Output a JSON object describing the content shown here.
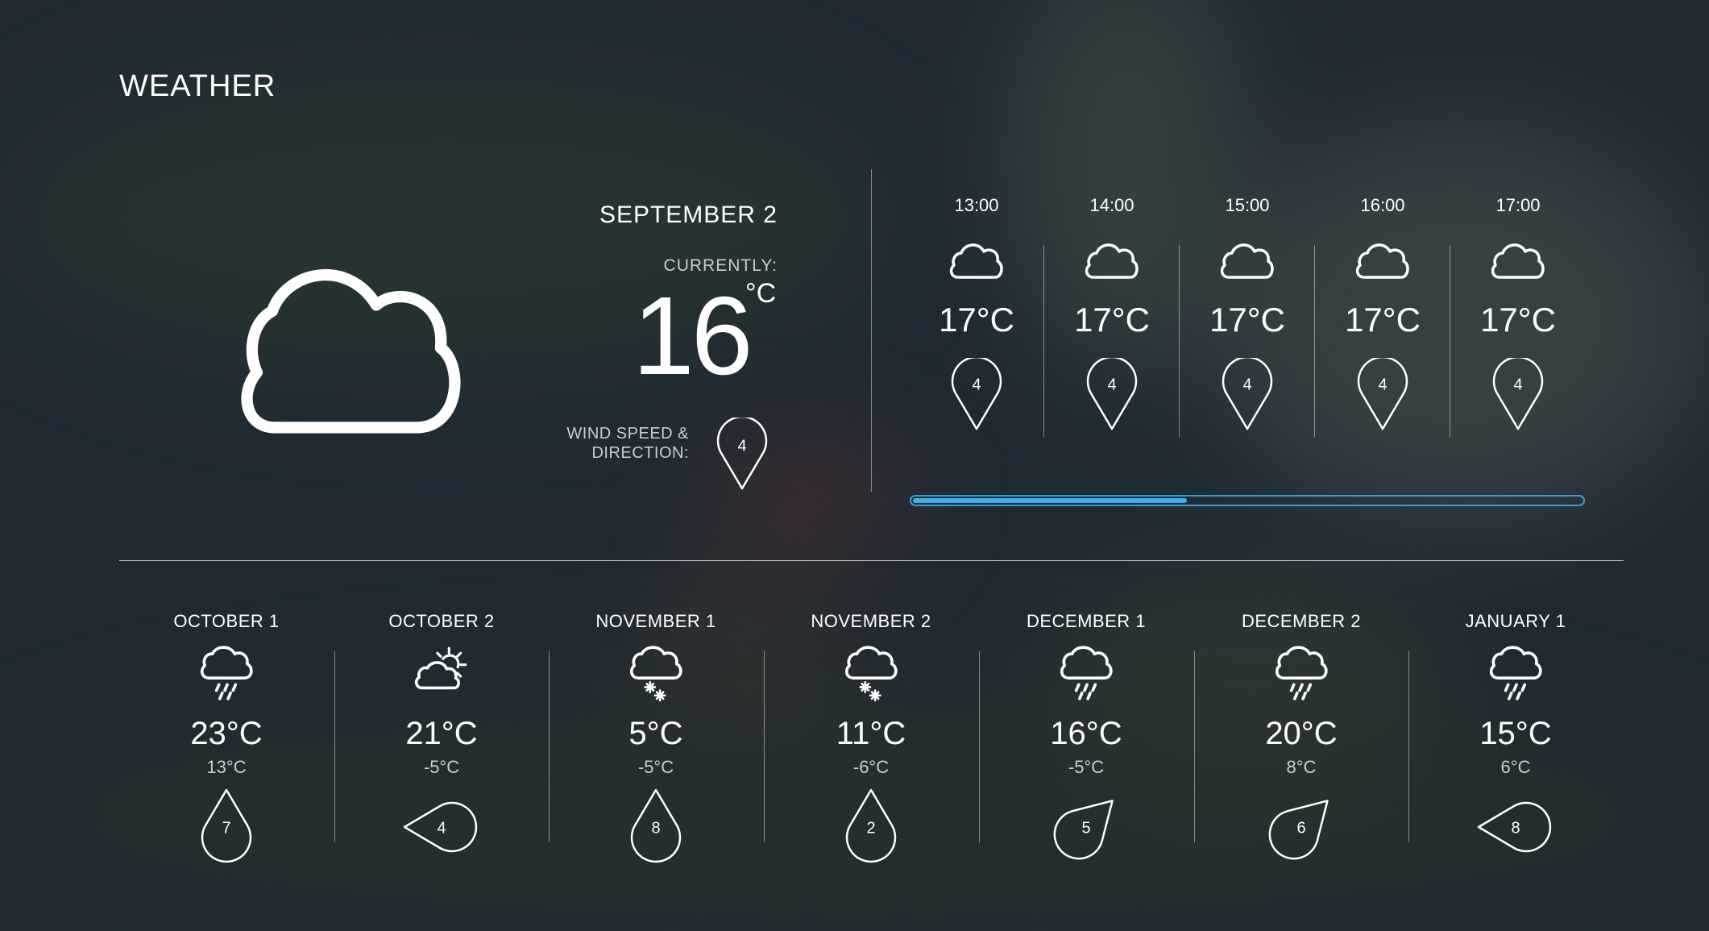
{
  "app": {
    "title": "WEATHER"
  },
  "current": {
    "date": "SEPTEMBER 2",
    "label": "CURRENTLY:",
    "temperature": "16",
    "unit": "°C",
    "icon": "cloud-icon",
    "wind_label": "WIND SPEED & DIRECTION:",
    "wind_speed": "4",
    "wind_direction": "south"
  },
  "hourly": [
    {
      "time": "13:00",
      "icon": "cloud-icon",
      "temp": "17°C",
      "wind_speed": "4",
      "wind_direction": "south"
    },
    {
      "time": "14:00",
      "icon": "cloud-icon",
      "temp": "17°C",
      "wind_speed": "4",
      "wind_direction": "south"
    },
    {
      "time": "15:00",
      "icon": "cloud-icon",
      "temp": "17°C",
      "wind_speed": "4",
      "wind_direction": "south"
    },
    {
      "time": "16:00",
      "icon": "cloud-icon",
      "temp": "17°C",
      "wind_speed": "4",
      "wind_direction": "south"
    },
    {
      "time": "17:00",
      "icon": "cloud-icon",
      "temp": "17°C",
      "wind_speed": "4",
      "wind_direction": "south"
    }
  ],
  "hourly_scroll": {
    "progress": 0.41,
    "color": "#3ab1ec"
  },
  "daily": [
    {
      "date": "OCTOBER 1",
      "icon": "rain-icon",
      "high": "23°C",
      "low": "13°C",
      "wind_speed": "7",
      "wind_direction": "north"
    },
    {
      "date": "OCTOBER 2",
      "icon": "partly-sunny-icon",
      "high": "21°C",
      "low": "-5°C",
      "wind_speed": "4",
      "wind_direction": "west"
    },
    {
      "date": "NOVEMBER 1",
      "icon": "snow-icon",
      "high": "5°C",
      "low": "-5°C",
      "wind_speed": "8",
      "wind_direction": "north"
    },
    {
      "date": "NOVEMBER 2",
      "icon": "snow-icon",
      "high": "11°C",
      "low": "-6°C",
      "wind_speed": "2",
      "wind_direction": "north"
    },
    {
      "date": "DECEMBER 1",
      "icon": "rain-icon",
      "high": "16°C",
      "low": "-5°C",
      "wind_speed": "5",
      "wind_direction": "north-east"
    },
    {
      "date": "DECEMBER 2",
      "icon": "rain-icon",
      "high": "20°C",
      "low": "8°C",
      "wind_speed": "6",
      "wind_direction": "north-east"
    },
    {
      "date": "JANUARY 1",
      "icon": "rain-icon",
      "high": "15°C",
      "low": "6°C",
      "wind_speed": "8",
      "wind_direction": "west"
    }
  ]
}
